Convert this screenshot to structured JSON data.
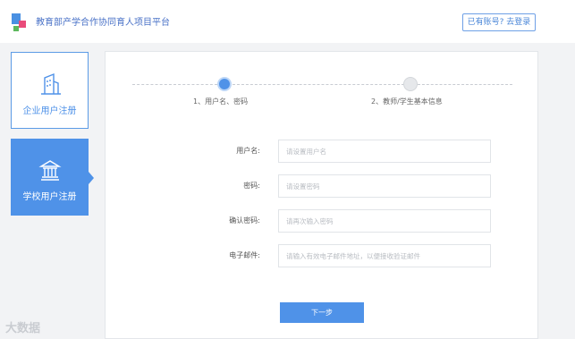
{
  "header": {
    "site_title": "教育部产学合作协同育人项目平台",
    "login_button": "已有账号? 去登录"
  },
  "sidebar": {
    "items": [
      {
        "label": "企业用户注册",
        "icon": "building-icon"
      },
      {
        "label": "学校用户注册",
        "icon": "school-icon"
      }
    ]
  },
  "steps": [
    {
      "label": "1、用户名、密码"
    },
    {
      "label": "2、教师/学生基本信息"
    }
  ],
  "form": {
    "username": {
      "label": "用户名:",
      "placeholder": "请设置用户名"
    },
    "password": {
      "label": "密码:",
      "placeholder": "请设置密码"
    },
    "confirm_password": {
      "label": "确认密码:",
      "placeholder": "请再次输入密码"
    },
    "email": {
      "label": "电子邮件:",
      "placeholder": "请输入有效电子邮件地址，以便接收验证邮件"
    }
  },
  "next_button": "下一步",
  "watermark": "大数据",
  "colors": {
    "accent": "#4f92e8",
    "background": "#f2f3f5"
  }
}
